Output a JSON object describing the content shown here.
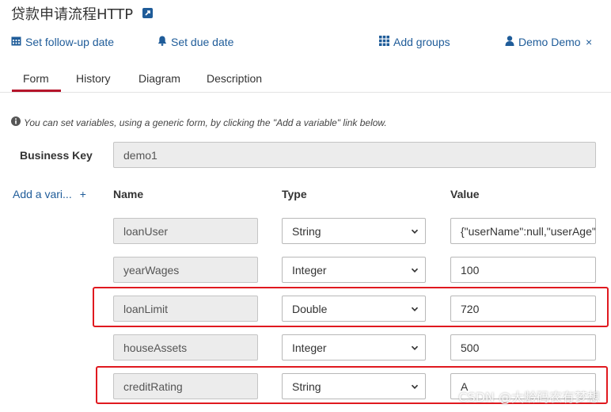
{
  "header": {
    "title": "贷款申请流程HTTP"
  },
  "toolbar": {
    "follow_up": "Set follow-up date",
    "due_date": "Set due date",
    "add_groups": "Add groups",
    "assignee": "Demo Demo",
    "remove": "×"
  },
  "tabs": [
    {
      "label": "Form",
      "active": true
    },
    {
      "label": "History",
      "active": false
    },
    {
      "label": "Diagram",
      "active": false
    },
    {
      "label": "Description",
      "active": false
    }
  ],
  "form": {
    "hint": "You can set variables, using a generic form, by clicking the \"Add a variable\" link below.",
    "business_key_label": "Business Key",
    "business_key_value": "demo1",
    "add_variable_label": "Add a vari...",
    "add_variable_plus": "+",
    "columns": {
      "name": "Name",
      "type": "Type",
      "value": "Value"
    },
    "variables": [
      {
        "name": "loanUser",
        "type": "String",
        "value": "{\"userName\":null,\"userAge\"",
        "highlighted": false
      },
      {
        "name": "yearWages",
        "type": "Integer",
        "value": "100",
        "highlighted": false
      },
      {
        "name": "loanLimit",
        "type": "Double",
        "value": "720",
        "highlighted": true
      },
      {
        "name": "houseAssets",
        "type": "Integer",
        "value": "500",
        "highlighted": false
      },
      {
        "name": "creditRating",
        "type": "String",
        "value": "A",
        "highlighted": true
      }
    ]
  },
  "watermark": "CSDN @大龄码农有梦想",
  "colors": {
    "link": "#1f5c99",
    "active_tab": "#b5152b",
    "highlight": "#e0191f"
  }
}
